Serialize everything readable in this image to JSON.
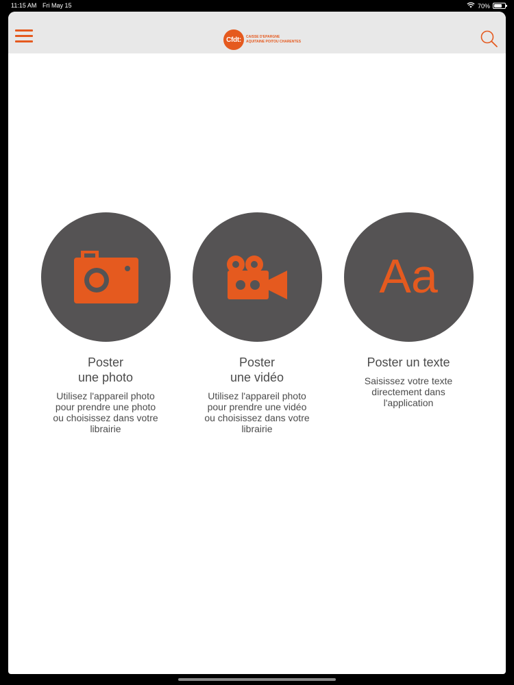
{
  "status_bar": {
    "time": "11:15 AM",
    "date": "Fri May 15",
    "battery": "70%",
    "battery_level": 0.7,
    "wifi_icon": "wifi-icon",
    "battery_icon": "battery-icon"
  },
  "nav": {
    "menu_icon": "hamburger-menu-icon",
    "search_icon": "search-icon",
    "logo_mark": "Cfdt:",
    "logo_line1": "CAISSE D'EPARGNE",
    "logo_line2": "AQUITAINE POITOU CHARENTES"
  },
  "options": [
    {
      "icon": "camera-icon",
      "title_line1": "Poster",
      "title_line2": "une photo",
      "description": "Utilisez l'appareil photo pour prendre une photo ou choisissez dans votre librairie"
    },
    {
      "icon": "video-camera-icon",
      "title_line1": "Poster",
      "title_line2": "une vidéo",
      "description": "Utilisez l'appareil photo pour prendre une vidéo ou choisissez dans votre librairie"
    },
    {
      "icon": "text-icon",
      "icon_text": "Aa",
      "title_line1": "Poster un texte",
      "title_line2": "",
      "description": "Saisissez votre texte directement dans l'application"
    }
  ],
  "colors": {
    "accent": "#e55a1f",
    "circle": "#555354",
    "nav_background": "#e8e8e8",
    "text": "#4b4b4b"
  }
}
